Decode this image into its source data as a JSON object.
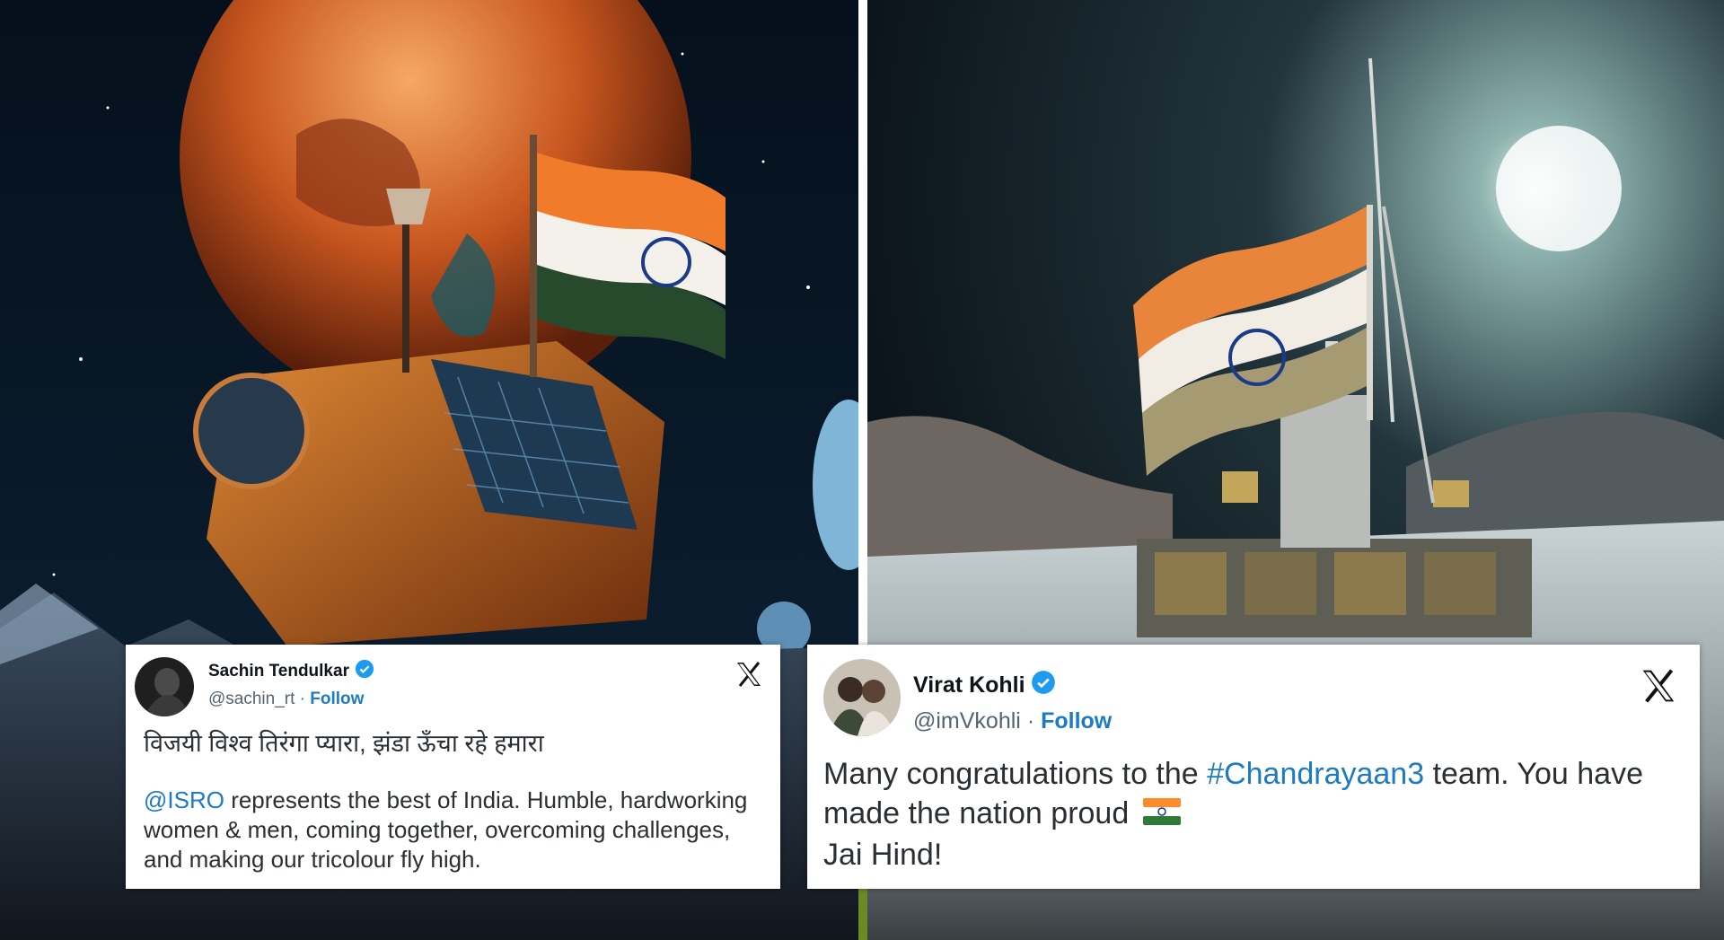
{
  "tweets": {
    "sachin": {
      "name": "Sachin Tendulkar",
      "handle": "@sachin_rt",
      "separator": "·",
      "follow": "Follow",
      "hindi_line": "विजयी विश्व तिरंगा प्यारा, झंडा ऊँचा रहे हमारा",
      "mention": "@ISRO",
      "body": " represents the best of India. Humble, hardworking women & men, coming together, overcoming challenges, and making our tricolour fly high."
    },
    "virat": {
      "name": "Virat Kohli",
      "handle": "@imVkohli",
      "separator": "·",
      "follow": "Follow",
      "body_start": "Many congratulations to the ",
      "hashtag": "#Chandrayaan3",
      "body_end": " team. You have made the nation proud",
      "sign_off": "Jai Hind!"
    }
  },
  "icons": {
    "verified": "verified-badge-icon",
    "x_logo": "x-logo-icon",
    "flag": "india-flag-emoji"
  },
  "colors": {
    "link": "#1d7bc4",
    "verified": "#1d9bf0",
    "saffron": "#ff8a2a",
    "green": "#2f7a36",
    "chakra": "#1b3a8a"
  }
}
